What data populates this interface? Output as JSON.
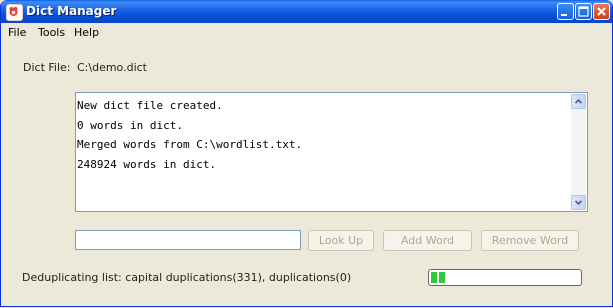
{
  "window": {
    "title": "Dict Manager"
  },
  "menu": {
    "items": [
      "File",
      "Tools",
      "Help"
    ]
  },
  "dict_file": {
    "label": "Dict File:",
    "path": "C:\\demo.dict"
  },
  "log": {
    "lines": [
      "New dict file created.",
      "0 words in dict.",
      "Merged words from C:\\wordlist.txt.",
      "248924 words in dict."
    ]
  },
  "word_input": {
    "value": ""
  },
  "buttons": {
    "look_up": "Look Up",
    "add_word": "Add Word",
    "remove_word": "Remove Word"
  },
  "status": {
    "text": "Deduplicating list: capital duplications(331), duplications(0)"
  },
  "progress": {
    "fraction": 0.1
  },
  "colors": {
    "titlebar": "#0550D8",
    "progress": "#2DCB3C",
    "face": "#ECE9D8"
  }
}
